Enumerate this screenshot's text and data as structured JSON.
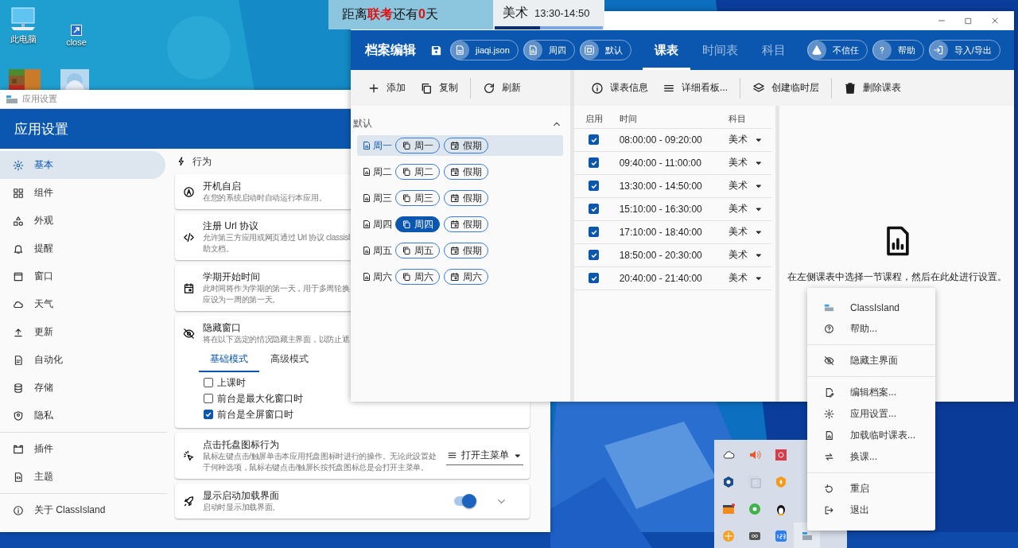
{
  "desktop": {
    "icons": [
      {
        "label": "此电脑"
      },
      {
        "label": "close"
      }
    ]
  },
  "countdown": {
    "text": "距离**联考**还有**0**天"
  },
  "current_lesson": {
    "subject": "美术",
    "time": "13:30-14:50",
    "level": 0.42
  },
  "settings_window": {
    "title": "应用设置",
    "header": "应用设置",
    "sidebar": {
      "groups": [
        [
          {
            "label": "基本",
            "selected": true
          },
          {
            "label": "组件",
            "selected": false
          },
          {
            "label": "外观",
            "selected": false
          },
          {
            "label": "提醒",
            "selected": false
          },
          {
            "label": "窗口",
            "selected": false
          },
          {
            "label": "天气",
            "selected": false
          },
          {
            "label": "更新",
            "selected": false
          },
          {
            "label": "自动化",
            "selected": false
          },
          {
            "label": "存储",
            "selected": false
          },
          {
            "label": "隐私",
            "selected": false
          }
        ],
        [
          {
            "label": "插件",
            "selected": false
          },
          {
            "label": "主题",
            "selected": false
          }
        ],
        [
          {
            "label": "关于 ClassIsland",
            "selected": false
          }
        ]
      ]
    },
    "section": "行为",
    "cards": [
      {
        "kind": "plain",
        "title": "开机自启",
        "description": "在您的系统启动时自动运行本应用。"
      },
      {
        "kind": "plain",
        "title": "注册 Url 协议",
        "description": "允许第三方应用或网页通过 Url 协议 classisl\n助文档。"
      },
      {
        "kind": "plain",
        "title": "学期开始时间",
        "description": "此时间将作为学期的第一天，用于多周轮换应设为一周的第一天。"
      },
      {
        "kind": "checklist",
        "title": "隐藏窗口",
        "description": "将在以下选定的情况隐藏主界面，以防止遮",
        "tabs": [
          {
            "label": "基础模式",
            "selected": true
          },
          {
            "label": "高级模式",
            "selected": false
          }
        ],
        "options": [
          {
            "label": "上课时",
            "checked": false
          },
          {
            "label": "前台是最大化窗口时",
            "checked": false
          },
          {
            "label": "前台是全屏窗口时",
            "checked": true
          }
        ]
      },
      {
        "kind": "dropdown",
        "title": "点击托盘图标行为",
        "description": "鼠标左键点击/触屏单击本应用托盘图标时进行的操作。无论此设置处于何种选项，鼠标右键点击/触屏长按托盘图标总是会打开主菜单。",
        "value": "打开主菜单"
      },
      {
        "kind": "toggle",
        "title": "显示启动加载界面",
        "description": "启动时显示加载界面。",
        "on": true,
        "expanded": false
      }
    ]
  },
  "editor_window": {
    "header": {
      "title": "档案编辑",
      "chips": [
        {
          "label": "jiaqi.json"
        },
        {
          "label": "周四"
        },
        {
          "label": "默认"
        }
      ],
      "tabs": [
        {
          "label": "课表",
          "selected": true
        },
        {
          "label": "时间表",
          "selected": false
        },
        {
          "label": "科目",
          "selected": false
        }
      ],
      "actions": [
        {
          "label": "不信任"
        },
        {
          "label": "帮助"
        },
        {
          "label": "导入/导出"
        }
      ]
    },
    "toolbar_left": [
      [
        "添加",
        "复制"
      ],
      [
        "刷新"
      ]
    ],
    "toolbar_right": [
      [
        "课表信息",
        "详细看板..."
      ],
      [
        "创建临时层"
      ],
      [
        "删除课表"
      ]
    ],
    "class_plans": {
      "group": "默认",
      "expanded": true,
      "rows": [
        {
          "day": "周一",
          "selected": true,
          "chips": [
            {
              "label": "周一",
              "selected": false
            },
            {
              "label": "假期",
              "selected": false
            }
          ]
        },
        {
          "day": "周二",
          "selected": false,
          "chips": [
            {
              "label": "周二",
              "selected": false
            },
            {
              "label": "假期",
              "selected": false
            }
          ]
        },
        {
          "day": "周三",
          "selected": false,
          "chips": [
            {
              "label": "周三",
              "selected": false
            },
            {
              "label": "假期",
              "selected": false
            }
          ]
        },
        {
          "day": "周四",
          "selected": false,
          "chips": [
            {
              "label": "周四",
              "selected": true
            },
            {
              "label": "假期",
              "selected": false
            }
          ]
        },
        {
          "day": "周五",
          "selected": false,
          "chips": [
            {
              "label": "周五",
              "selected": false
            },
            {
              "label": "假期",
              "selected": false
            }
          ]
        },
        {
          "day": "周六",
          "selected": false,
          "chips": [
            {
              "label": "周六",
              "selected": false
            },
            {
              "label": "周六",
              "selected": false
            }
          ]
        }
      ]
    },
    "table": {
      "columns": [
        "启用",
        "时间",
        "科目"
      ],
      "rows": [
        {
          "enabled": true,
          "time": "08:00:00 - 09:20:00",
          "subject": "美术"
        },
        {
          "enabled": true,
          "time": "09:40:00 - 11:00:00",
          "subject": "美术"
        },
        {
          "enabled": true,
          "time": "13:30:00 - 14:50:00",
          "subject": "美术"
        },
        {
          "enabled": true,
          "time": "15:10:00 - 16:30:00",
          "subject": "美术"
        },
        {
          "enabled": true,
          "time": "17:10:00 - 18:40:00",
          "subject": "美术"
        },
        {
          "enabled": true,
          "time": "18:50:00 - 20:30:00",
          "subject": "美术"
        },
        {
          "enabled": true,
          "time": "20:40:00 - 21:40:00",
          "subject": "美术"
        }
      ]
    },
    "hint": "在左侧课表中选择一节课程，然后在此处进行设置。"
  },
  "tray_menu": {
    "items": [
      {
        "kind": "item",
        "label": "ClassIsland"
      },
      {
        "kind": "item",
        "label": "帮助..."
      },
      {
        "kind": "separator"
      },
      {
        "kind": "item",
        "label": "隐藏主界面"
      },
      {
        "kind": "separator"
      },
      {
        "kind": "item",
        "label": "编辑档案..."
      },
      {
        "kind": "item",
        "label": "应用设置..."
      },
      {
        "kind": "item",
        "label": "加载临时课表..."
      },
      {
        "kind": "item",
        "label": "换课..."
      },
      {
        "kind": "separator"
      },
      {
        "kind": "item",
        "label": "重启"
      },
      {
        "kind": "item",
        "label": "退出"
      }
    ]
  }
}
